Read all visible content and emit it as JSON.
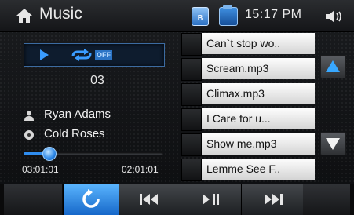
{
  "header": {
    "title": "Music",
    "time": "15:17 PM",
    "bluetooth_symbol": "ʙ",
    "icons": [
      "home-icon",
      "bluetooth-icon",
      "media-icon",
      "volume-icon"
    ]
  },
  "player": {
    "repeat_state": "OFF",
    "track_number": "03",
    "artist": "Ryan Adams",
    "album": "Cold Roses",
    "elapsed": "03:01:01",
    "total": "02:01:01",
    "progress": 0.18
  },
  "playlist": {
    "items": [
      "Can`t stop wo..",
      "Scream.mp3",
      "Climax.mp3",
      "I Care for u...",
      "Show me.mp3",
      "Lemme See F.."
    ]
  },
  "controls": {
    "buttons": [
      "repeat-icon",
      "previous-icon",
      "play-pause-icon",
      "next-icon"
    ]
  },
  "colors": {
    "accent": "#2f8df0",
    "active_button": "#3a9cff",
    "list_bg": "#e8e8e8"
  }
}
